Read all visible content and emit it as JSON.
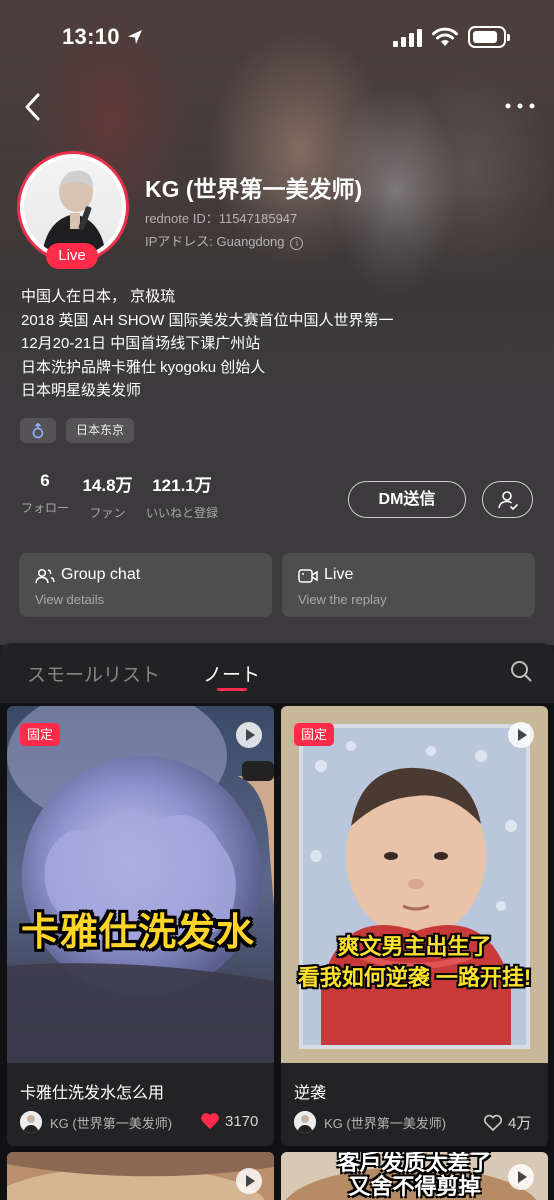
{
  "status_bar": {
    "time": "13:10"
  },
  "profile": {
    "name": "KG (世界第一美发师)",
    "live_badge": "Live",
    "rednote_id": "rednote ID：11547185947",
    "ip_location": "IPアドレス: Guangdong",
    "bio_lines": [
      "中国人在日本， 京极琉",
      "2018 英国 AH SHOW 国际美发大赛首位中国人世界第一",
      "12月20-21日 中国首场线下课广州站",
      "日本洗护品牌卡雅仕 kyogoku 创始人",
      "日本明星级美发师"
    ],
    "tags": {
      "gender_icon": "male-icon",
      "location": "日本东京"
    }
  },
  "stats": [
    {
      "value": "6",
      "label": "フォロー"
    },
    {
      "value": "14.8万",
      "label": "ファン"
    },
    {
      "value": "121.1万",
      "label": "いいねと登録"
    }
  ],
  "actions": {
    "dm_label": "DM送信"
  },
  "cards": [
    {
      "title": "Group chat",
      "subtitle": "View details",
      "icon": "group-icon"
    },
    {
      "title": "Live",
      "subtitle": "View the replay",
      "icon": "video-camera-icon"
    }
  ],
  "tabs": {
    "left": "スモールリスト",
    "active": "ノート"
  },
  "notes": [
    {
      "pin": "固定",
      "overlay": "卡雅仕洗发水",
      "title": "卡雅仕洗发水怎么用",
      "author": "KG (世界第一美发师)",
      "likes": "3170",
      "liked": true
    },
    {
      "pin": "固定",
      "overlay_line1": "爽文男主出生了",
      "overlay_line2": "看我如何逆袭  一路开挂!",
      "title": "逆袭",
      "author": "KG (世界第一美发师)",
      "likes": "4万",
      "liked": false
    },
    {
      "overlay_line1": "客戶发质太差了",
      "overlay_line2": "又舍不得剪掉"
    }
  ],
  "colors": {
    "accent": "#ff2b49",
    "background": "#1d1d1f"
  }
}
